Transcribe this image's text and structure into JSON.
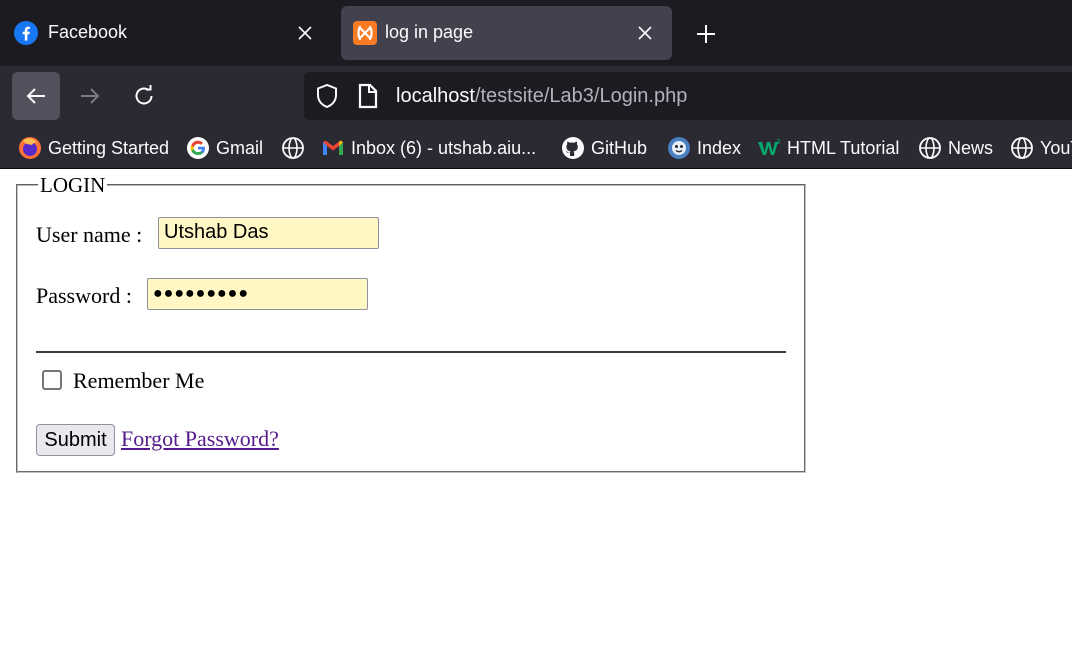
{
  "browser": {
    "tabs": [
      {
        "title": "Facebook",
        "icon": "facebook-icon",
        "active": false
      },
      {
        "title": "log in page",
        "icon": "xampp-icon",
        "active": true
      }
    ],
    "url": {
      "host": "localhost",
      "path": "/testsite/Lab3/Login.php"
    },
    "bookmarks": [
      {
        "label": "Getting Started",
        "icon": "firefox-icon"
      },
      {
        "label": "Gmail",
        "icon": "google-icon"
      },
      {
        "label": "",
        "icon": "globe-icon"
      },
      {
        "label": "Inbox (6) - utshab.aiu...",
        "icon": "gmail-icon"
      },
      {
        "label": "GitHub",
        "icon": "github-icon"
      },
      {
        "label": "Index",
        "icon": "index-icon"
      },
      {
        "label": "HTML Tutorial",
        "icon": "w3schools-icon"
      },
      {
        "label": "News",
        "icon": "globe-icon"
      },
      {
        "label": "YouT",
        "icon": "globe-icon"
      }
    ],
    "colors": {
      "tabstrip": "#1c1b22",
      "toolbar": "#2b2a33",
      "active_tab": "#42414d"
    }
  },
  "login_form": {
    "legend": "LOGIN",
    "username_label": "User name :",
    "username_value": "Utshab Das",
    "password_label": "Password :",
    "password_masked": "●●●●●●●●●",
    "remember_label": "Remember Me",
    "remember_checked": false,
    "submit_label": "Submit",
    "forgot_link": "Forgot Password?",
    "colors": {
      "input_autofill": "#fff7c4",
      "visited_link": "#551a8b"
    }
  }
}
